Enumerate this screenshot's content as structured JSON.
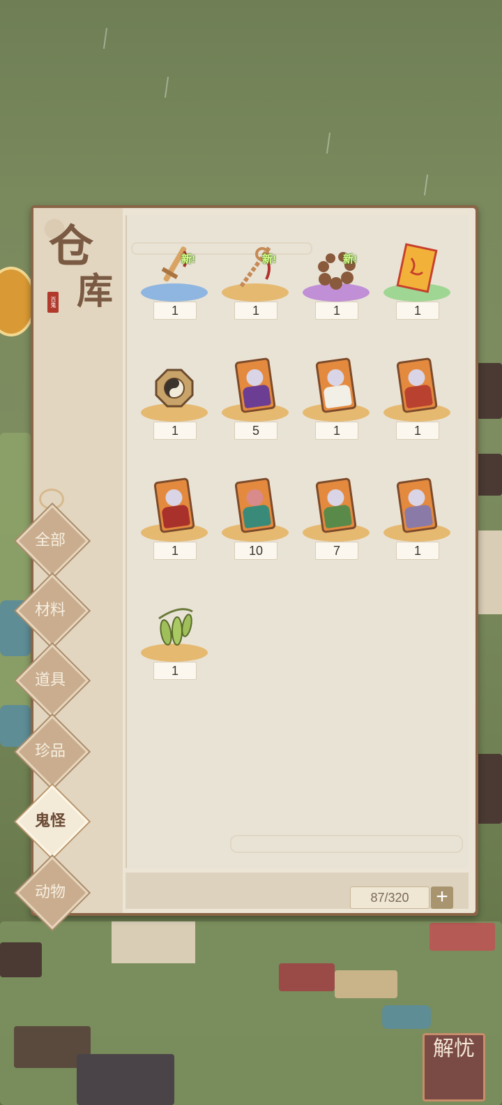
{
  "panel": {
    "title_main": "仓",
    "title_sub": "库",
    "seal_text": "百鬼"
  },
  "tabs": [
    {
      "label": "全部",
      "active": false
    },
    {
      "label": "材料",
      "active": false
    },
    {
      "label": "道具",
      "active": false
    },
    {
      "label": "珍品",
      "active": false
    },
    {
      "label": "鬼怪",
      "active": true
    },
    {
      "label": "动物",
      "active": false
    }
  ],
  "items": [
    {
      "icon": "wooden-sword-icon",
      "count": "1",
      "new_label": "新!",
      "pedestal_color": "#8fb6e0"
    },
    {
      "icon": "talisman-knot-icon",
      "count": "1",
      "new_label": "新!",
      "pedestal_color": "#e6b970"
    },
    {
      "icon": "prayer-beads-icon",
      "count": "1",
      "new_label": "新!",
      "pedestal_color": "#c08fd6"
    },
    {
      "icon": "paper-charm-icon",
      "count": "1",
      "new_label": "",
      "pedestal_color": "#9fd693"
    },
    {
      "icon": "bagua-mirror-icon",
      "count": "1",
      "new_label": "",
      "pedestal_color": "#e6b970"
    },
    {
      "icon": "ghost-card-purple-icon",
      "count": "5",
      "new_label": "",
      "pedestal_color": "#e6b970"
    },
    {
      "icon": "ghost-card-scholar-icon",
      "count": "1",
      "new_label": "",
      "pedestal_color": "#e6b970"
    },
    {
      "icon": "ghost-card-elder-icon",
      "count": "1",
      "new_label": "",
      "pedestal_color": "#e6b970"
    },
    {
      "icon": "ghost-card-maiden-icon",
      "count": "1",
      "new_label": "",
      "pedestal_color": "#e6b970"
    },
    {
      "icon": "ghost-card-demon-icon",
      "count": "10",
      "new_label": "",
      "pedestal_color": "#e6b970"
    },
    {
      "icon": "ghost-card-farmer-icon",
      "count": "7",
      "new_label": "",
      "pedestal_color": "#e6b970"
    },
    {
      "icon": "ghost-card-bookkeeper-icon",
      "count": "1",
      "new_label": "",
      "pedestal_color": "#e6b970"
    },
    {
      "icon": "soybean-pods-icon",
      "count": "1",
      "new_label": "",
      "pedestal_color": "#e6b970"
    }
  ],
  "capacity": "87/320",
  "plus_label": "+",
  "corner_button": "解忧",
  "colors": {
    "frame": "#8a6446",
    "paper": "#ece5d6",
    "tab_inactive": "#c9ad8e",
    "tab_active": "#f3ead8",
    "new_badge": "#d9ff8c"
  }
}
